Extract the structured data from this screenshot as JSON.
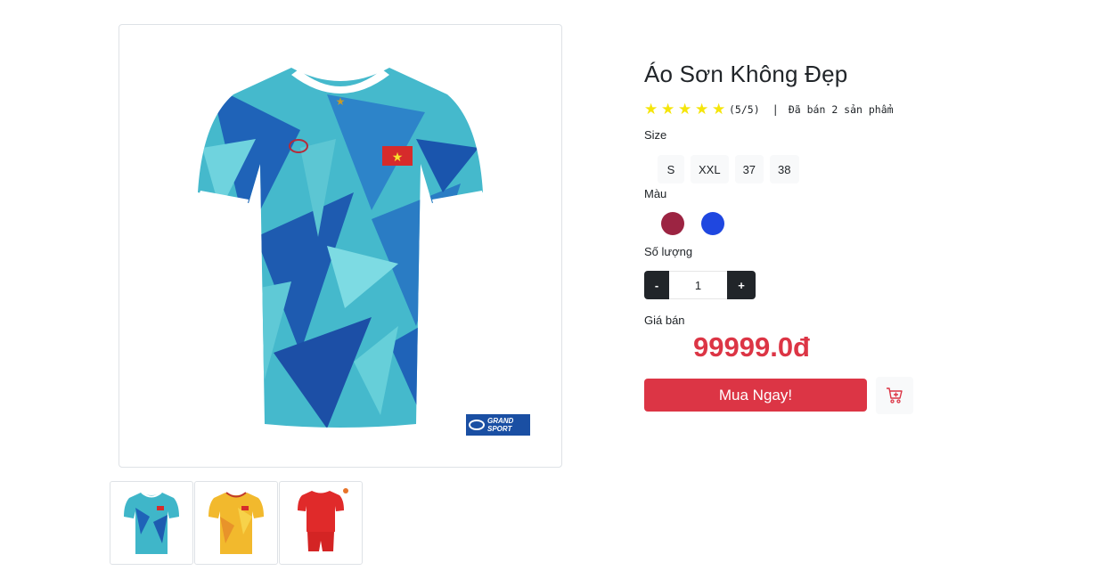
{
  "product": {
    "title": "Áo Sơn Không Đẹp",
    "rating_text": "(5/5)",
    "stars": 5,
    "separator": "|",
    "sold_text": "Đã bán 2 sản phẩm",
    "brand_logo_line1": "GRAND",
    "brand_logo_line2": "SPORT"
  },
  "options": {
    "size_label": "Size",
    "sizes": [
      "S",
      "XXL",
      "37",
      "38"
    ],
    "color_label": "Màu",
    "colors": [
      "#9c2442",
      "#1f47e0"
    ]
  },
  "quantity": {
    "label": "Số lượng",
    "minus": "-",
    "plus": "+",
    "value": "1"
  },
  "price": {
    "label": "Giá bán",
    "value": "99999.0đ"
  },
  "actions": {
    "buy_label": "Mua Ngay!",
    "cart_icon": "cart-plus-icon"
  },
  "thumbnails": [
    {
      "icon": "jersey-teal-icon",
      "color": "#3fb6c9"
    },
    {
      "icon": "jersey-yellow-icon",
      "color": "#f2b92d"
    },
    {
      "icon": "kit-red-icon",
      "color": "#e02a2a"
    }
  ]
}
